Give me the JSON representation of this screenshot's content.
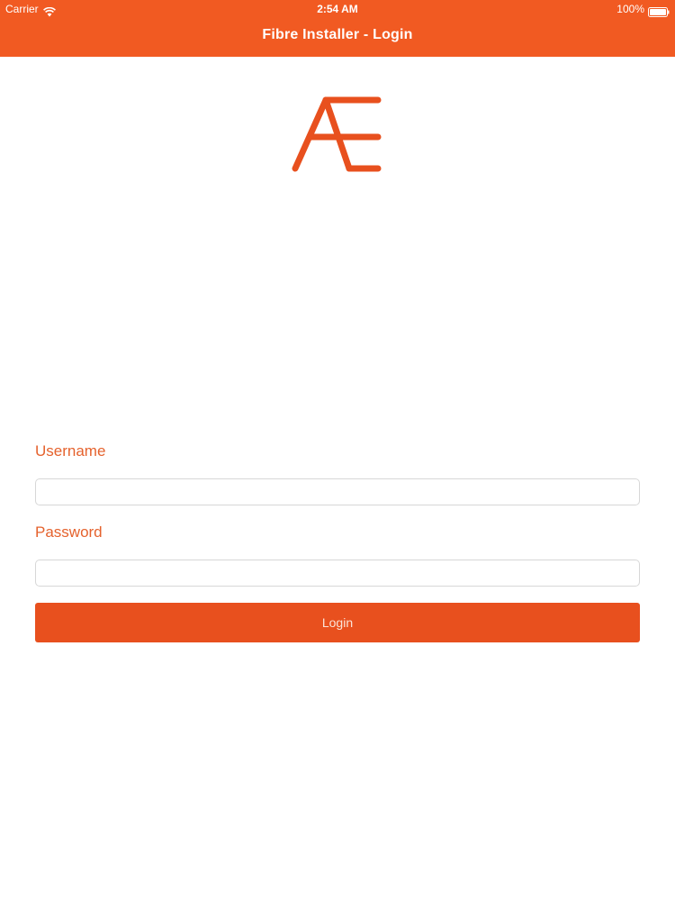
{
  "status_bar": {
    "carrier": "Carrier",
    "time": "2:54 AM",
    "battery": "100%",
    "wifi_icon": "wifi-icon",
    "battery_icon": "battery-full-icon"
  },
  "nav": {
    "title": "Fibre Installer - Login"
  },
  "logo": {
    "name": "ae-logo"
  },
  "form": {
    "username_label": "Username",
    "username_value": "",
    "username_placeholder": "",
    "password_label": "Password",
    "password_value": "",
    "password_placeholder": "",
    "login_label": "Login"
  },
  "colors": {
    "accent": "#f15a22",
    "label": "#e5622d",
    "button": "#e8501e"
  }
}
